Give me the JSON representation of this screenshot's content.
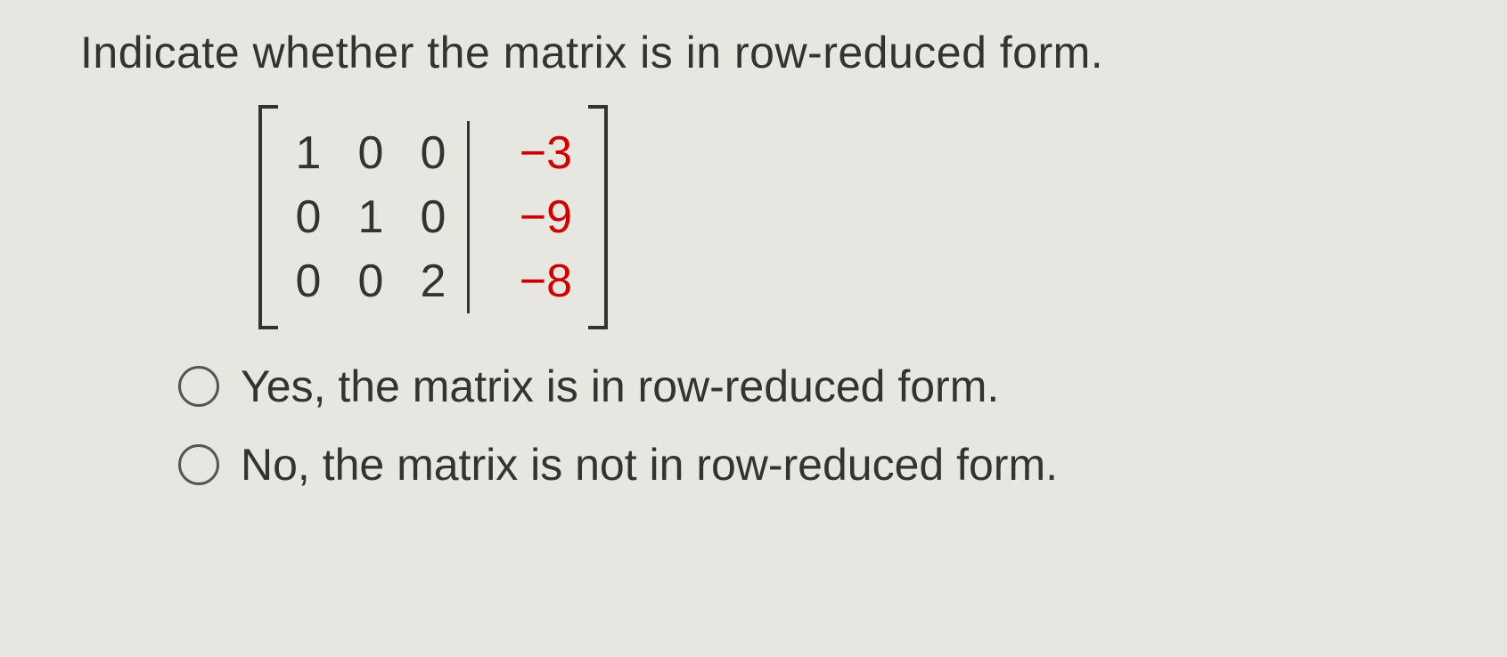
{
  "question": "Indicate whether the matrix is in row-reduced form.",
  "matrix": {
    "rows": [
      {
        "c0": "1",
        "c1": "0",
        "c2": "0",
        "aug": "−3"
      },
      {
        "c0": "0",
        "c1": "1",
        "c2": "0",
        "aug": "−9"
      },
      {
        "c0": "0",
        "c1": "0",
        "c2": "2",
        "aug": "−8"
      }
    ]
  },
  "options": {
    "yes": "Yes, the matrix is in row-reduced form.",
    "no": "No, the matrix is not in row-reduced form."
  }
}
